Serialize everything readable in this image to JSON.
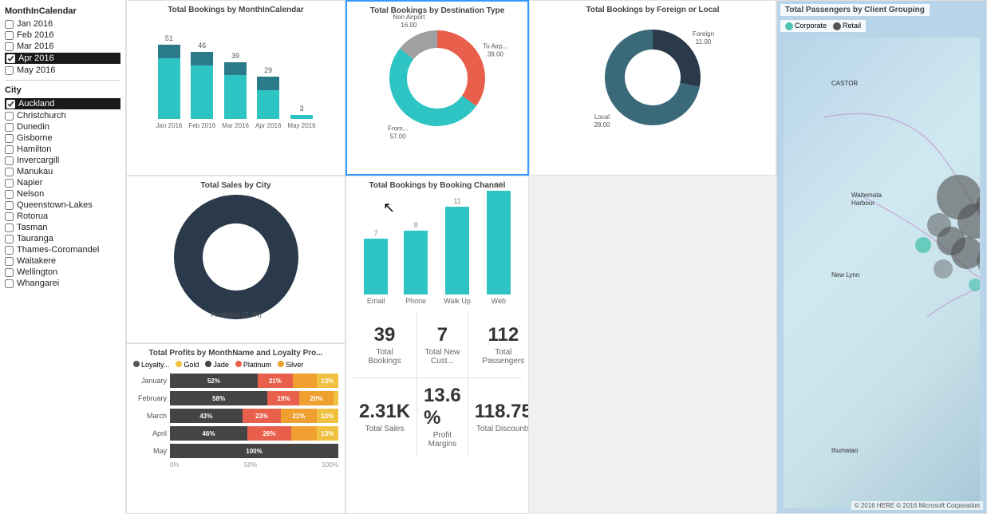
{
  "filters": {
    "month_title": "MonthInCalendar",
    "months": [
      {
        "label": "Jan 2016",
        "checked": false
      },
      {
        "label": "Feb 2016",
        "checked": false
      },
      {
        "label": "Mar 2016",
        "checked": false
      },
      {
        "label": "Apr 2016",
        "checked": true,
        "selected": true
      },
      {
        "label": "May 2016",
        "checked": false
      }
    ],
    "city_title": "City",
    "cities": [
      {
        "label": "Auckland",
        "selected": true
      },
      {
        "label": "Christchurch",
        "selected": false
      },
      {
        "label": "Dunedin",
        "selected": false
      },
      {
        "label": "Gisborne",
        "selected": false
      },
      {
        "label": "Hamilton",
        "selected": false
      },
      {
        "label": "Invercargill",
        "selected": false
      },
      {
        "label": "Manukau",
        "selected": false
      },
      {
        "label": "Napier",
        "selected": false
      },
      {
        "label": "Nelson",
        "selected": false
      },
      {
        "label": "Queenstown-Lakes",
        "selected": false
      },
      {
        "label": "Rotorua",
        "selected": false
      },
      {
        "label": "Tasman",
        "selected": false
      },
      {
        "label": "Tauranga",
        "selected": false
      },
      {
        "label": "Thames-Coromandel",
        "selected": false
      },
      {
        "label": "Waitakere",
        "selected": false
      },
      {
        "label": "Wellington",
        "selected": false
      },
      {
        "label": "Whangarei",
        "selected": false
      }
    ]
  },
  "bookings_by_month": {
    "title": "Total Bookings by MonthInCalendar",
    "bars": [
      {
        "label": "Jan\n2016",
        "teal": 42,
        "dark": 9,
        "total": 51
      },
      {
        "label": "Feb\n2016",
        "teal": 37,
        "dark": 9,
        "total": 46
      },
      {
        "label": "Mar\n2016",
        "teal": 30,
        "dark": 9,
        "total": 39
      },
      {
        "label": "Apr\n2016",
        "teal": 20,
        "dark": 9,
        "total": 29
      },
      {
        "label": "May\n2016",
        "teal": 3,
        "dark": 0,
        "total": 3
      }
    ]
  },
  "bookings_by_destination": {
    "title": "Total Bookings by Destination Type",
    "segments": [
      {
        "label": "To Airp...\n39.00",
        "value": 39,
        "color": "#e8604c"
      },
      {
        "label": "From...\n57.00",
        "value": 57,
        "color": "#2ec4c4"
      },
      {
        "label": "Non Airport\n16.00",
        "value": 16,
        "color": "#a0a0a0"
      }
    ]
  },
  "bookings_foreign_local": {
    "title": "Total Bookings by Foreign or Local",
    "segments": [
      {
        "label": "Foreign\n11.00",
        "value": 11,
        "color": "#2a3a4a"
      },
      {
        "label": "Local\n28.00",
        "value": 28,
        "color": "#3a6a7a"
      }
    ]
  },
  "total_sales_city": {
    "title": "Total Sales by City",
    "label": "Auckland (2.3K)"
  },
  "bookings_by_channel": {
    "title": "Total Bookings by Booking Channel",
    "bars": [
      {
        "label": "Email",
        "value": 7,
        "height": 70
      },
      {
        "label": "Phone",
        "value": 8,
        "height": 80
      },
      {
        "label": "Walk Up",
        "value": 11,
        "height": 110
      },
      {
        "label": "Web",
        "value": 13,
        "height": 130
      }
    ]
  },
  "kpis": [
    {
      "value": "39",
      "label": "Total Bookings"
    },
    {
      "value": "7",
      "label": "Total New Cust..."
    },
    {
      "value": "112",
      "label": "Total Passengers"
    },
    {
      "value": "2.31K",
      "label": "Total Sales"
    },
    {
      "value": "13.6 %",
      "label": "Profit Margins"
    },
    {
      "value": "118.75",
      "label": "Total Discounts"
    }
  ],
  "profits": {
    "title": "Total Profits by MonthName and Loyalty Pro...",
    "legend": [
      {
        "label": "Loyalty...",
        "color": "#555"
      },
      {
        "label": "Gold",
        "color": "#f0c040"
      },
      {
        "label": "Jade",
        "color": "#444"
      },
      {
        "label": "Platinum",
        "color": "#e8604c"
      },
      {
        "label": "Silver",
        "color": "#f0a030"
      }
    ],
    "rows": [
      {
        "month": "January",
        "segs": [
          {
            "pct": 52,
            "color": "#444",
            "label": "52%"
          },
          {
            "pct": 21,
            "color": "#e8604c",
            "label": "21%"
          },
          {
            "pct": 14,
            "color": "#f0a030",
            "label": ""
          },
          {
            "pct": 13,
            "color": "#f0c040",
            "label": "13%"
          }
        ]
      },
      {
        "month": "February",
        "segs": [
          {
            "pct": 58,
            "color": "#444",
            "label": "58%"
          },
          {
            "pct": 19,
            "color": "#e8604c",
            "label": "19%"
          },
          {
            "pct": 20,
            "color": "#f0a030",
            "label": "20%"
          },
          {
            "pct": 3,
            "color": "#f0c040",
            "label": ""
          }
        ]
      },
      {
        "month": "March",
        "segs": [
          {
            "pct": 43,
            "color": "#444",
            "label": "43%"
          },
          {
            "pct": 23,
            "color": "#e8604c",
            "label": "23%"
          },
          {
            "pct": 21,
            "color": "#f0a030",
            "label": "21%"
          },
          {
            "pct": 13,
            "color": "#f0c040",
            "label": "13%"
          }
        ]
      },
      {
        "month": "April",
        "segs": [
          {
            "pct": 46,
            "color": "#444",
            "label": "46%"
          },
          {
            "pct": 26,
            "color": "#e8604c",
            "label": "26%"
          },
          {
            "pct": 15,
            "color": "#f0a030",
            "label": ""
          },
          {
            "pct": 13,
            "color": "#f0c040",
            "label": "13%"
          }
        ]
      },
      {
        "month": "May",
        "segs": [
          {
            "pct": 100,
            "color": "#444",
            "label": "100%"
          },
          {
            "pct": 0,
            "color": "#e8604c",
            "label": ""
          },
          {
            "pct": 0,
            "color": "#f0a030",
            "label": ""
          },
          {
            "pct": 0,
            "color": "#f0c040",
            "label": ""
          }
        ]
      }
    ],
    "axis": [
      "0%",
      "50%",
      "100%"
    ]
  },
  "map": {
    "title": "Total Passengers by Client Grouping",
    "legend": [
      {
        "label": "Corporate",
        "color": "#4fc4b0"
      },
      {
        "label": "Retail",
        "color": "#555"
      }
    ],
    "bing_credit": "© 2016 HERE  © 2016 Microsoft Corporation"
  }
}
